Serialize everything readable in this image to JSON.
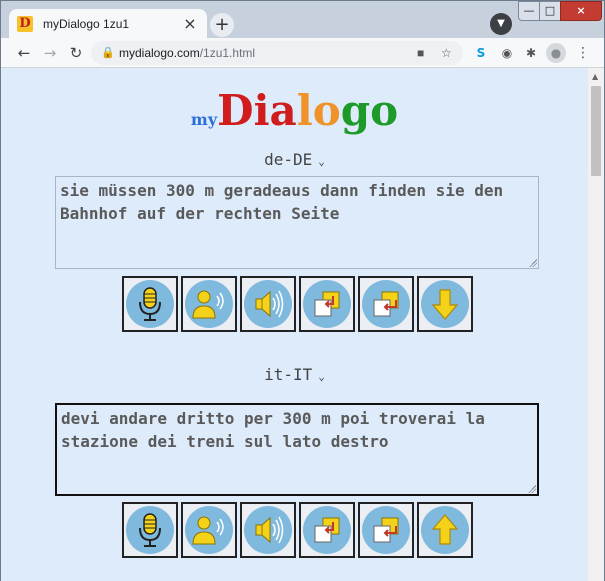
{
  "browser": {
    "tab_title": "myDialogo 1zu1",
    "tab_favicon_letter": "D",
    "url_host": "mydialogo.com",
    "url_path": "/1zu1.html"
  },
  "logo": {
    "my": "my",
    "parts": [
      {
        "text": "Dia",
        "color": "#d01c1c"
      },
      {
        "text": "lo",
        "color": "#f0922a"
      },
      {
        "text": "go",
        "color": "#1e9a2a"
      }
    ]
  },
  "source": {
    "language": "de-DE",
    "text": "sie müssen 300 m geradeaus dann finden sie den Bahnhof auf der rechten Seite"
  },
  "target": {
    "language": "it-IT",
    "text": "devi andare dritto per 300 m poi troverai la stazione dei treni sul lato destro"
  },
  "controls": {
    "button_circle_color": "#7fb9de",
    "icons": [
      "microphone-icon",
      "speaker-person-icon",
      "volume-icon",
      "copy-icon",
      "paste-icon",
      "arrow-icon"
    ],
    "source_arrow": "down",
    "target_arrow": "up"
  },
  "colors": {
    "page_background": "#ddebfa",
    "icon_yellow": "#f5d21a",
    "icon_red": "#c0392b"
  }
}
